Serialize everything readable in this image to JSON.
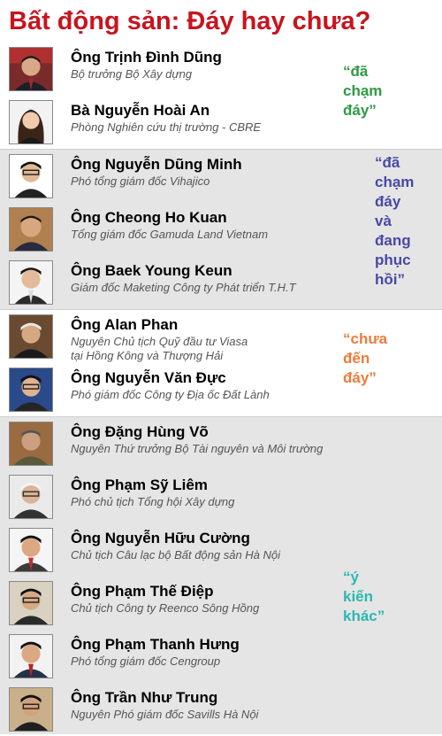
{
  "title": "Bất động sản: Đáy hay chưa?",
  "colors": {
    "title": "#c8141e",
    "quote_green": "#2e9a44",
    "quote_blue": "#4848a8",
    "quote_orange": "#f07a3a",
    "quote_teal": "#2bb8b0"
  },
  "groups": [
    {
      "quote_lines": [
        "“đã",
        "chạm",
        "đáy”"
      ],
      "people": [
        {
          "name": "Ông Trịnh Đình Dũng",
          "role": "Bộ trưởng Bộ Xây dựng"
        },
        {
          "name": "Bà Nguyễn Hoài An",
          "role": "Phòng Nghiên cứu thị trường - CBRE"
        }
      ]
    },
    {
      "quote_lines": [
        "“đã",
        "chạm",
        "đáy",
        "và",
        "đang",
        "phục",
        "hồi”"
      ],
      "people": [
        {
          "name": "Ông Nguyễn Dũng Minh",
          "role": "Phó tổng giám đốc Vihajico"
        },
        {
          "name": "Ông Cheong Ho Kuan",
          "role": "Tổng giám đốc Gamuda Land Vietnam"
        },
        {
          "name": "Ông Baek Young Keun",
          "role": "Giám đốc Maketing Công ty Phát triển T.H.T"
        }
      ]
    },
    {
      "quote_lines": [
        "“chưa",
        "đến",
        "đáy”"
      ],
      "people": [
        {
          "name": "Ông Alan Phan",
          "role_lines": [
            "Nguyên Chủ tịch Quỹ đầu tư Viasa",
            "tại Hồng Kông và Thượng Hải"
          ]
        },
        {
          "name": "Ông Nguyễn Văn Đực",
          "role": "Phó giám đốc Công ty Địa ốc Đất Lành"
        }
      ]
    },
    {
      "quote_lines": [
        "“ý",
        "kiến",
        "khác”"
      ],
      "people": [
        {
          "name": "Ông Đặng Hùng Võ",
          "role": "Nguyên Thứ trưởng Bộ Tài nguyên và Môi trường"
        },
        {
          "name": "Ông Phạm Sỹ Liêm",
          "role": "Phó chủ tịch Tổng hội Xây dựng"
        },
        {
          "name": "Ông Nguyễn Hữu Cường",
          "role": "Chủ tịch Câu lạc bộ Bất động sản Hà Nội"
        },
        {
          "name": "Ông Phạm Thế Điệp",
          "role": "Chủ tịch Công ty Reenco Sông Hồng"
        },
        {
          "name": "Ông Phạm Thanh Hưng",
          "role": "Phó tổng giám đốc Cengroup"
        },
        {
          "name": "Ông Trần Như Trung",
          "role": "Nguyên Phó giám đốc Savills Hà Nội"
        }
      ]
    }
  ]
}
